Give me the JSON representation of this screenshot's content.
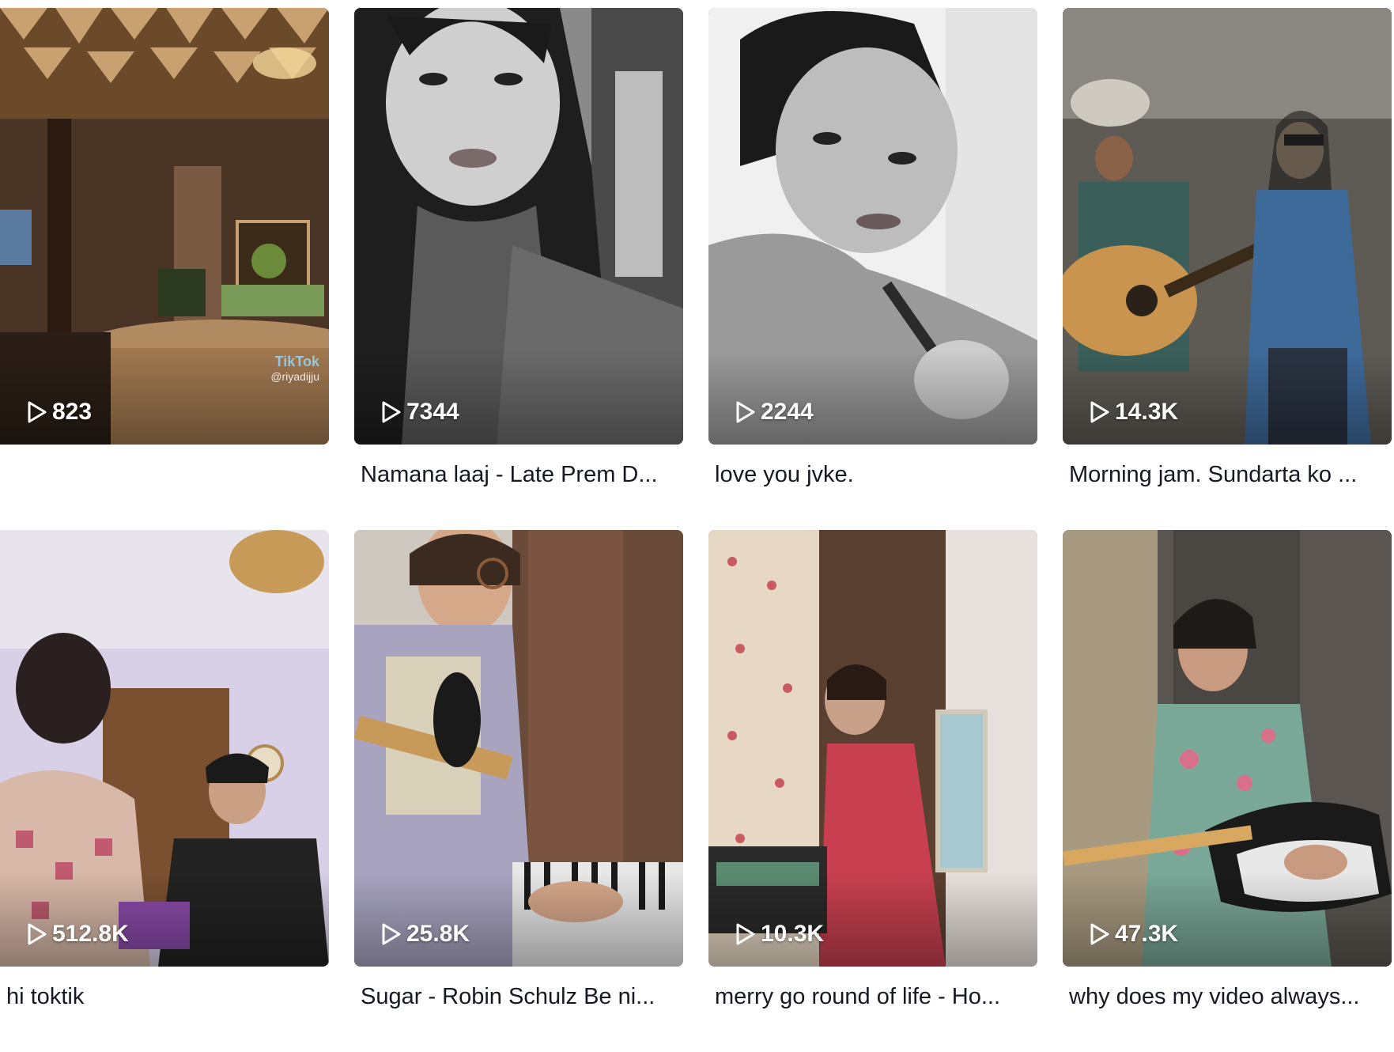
{
  "videos": [
    {
      "views": "823",
      "caption": "",
      "watermark": {
        "brand": "TikTok",
        "handle": "@riyadijju"
      }
    },
    {
      "views": "7344",
      "caption": "Namana laaj - Late Prem D..."
    },
    {
      "views": "2244",
      "caption": "love you jvke."
    },
    {
      "views": "14.3K",
      "caption": "Morning jam. Sundarta ko ..."
    },
    {
      "views": "512.8K",
      "caption": "hi toktik"
    },
    {
      "views": "25.8K",
      "caption": "Sugar - Robin Schulz Be ni..."
    },
    {
      "views": "10.3K",
      "caption": "merry go round of life - Ho..."
    },
    {
      "views": "47.3K",
      "caption": "why does my video always..."
    }
  ],
  "icons": {
    "views": "play-outline-icon"
  }
}
